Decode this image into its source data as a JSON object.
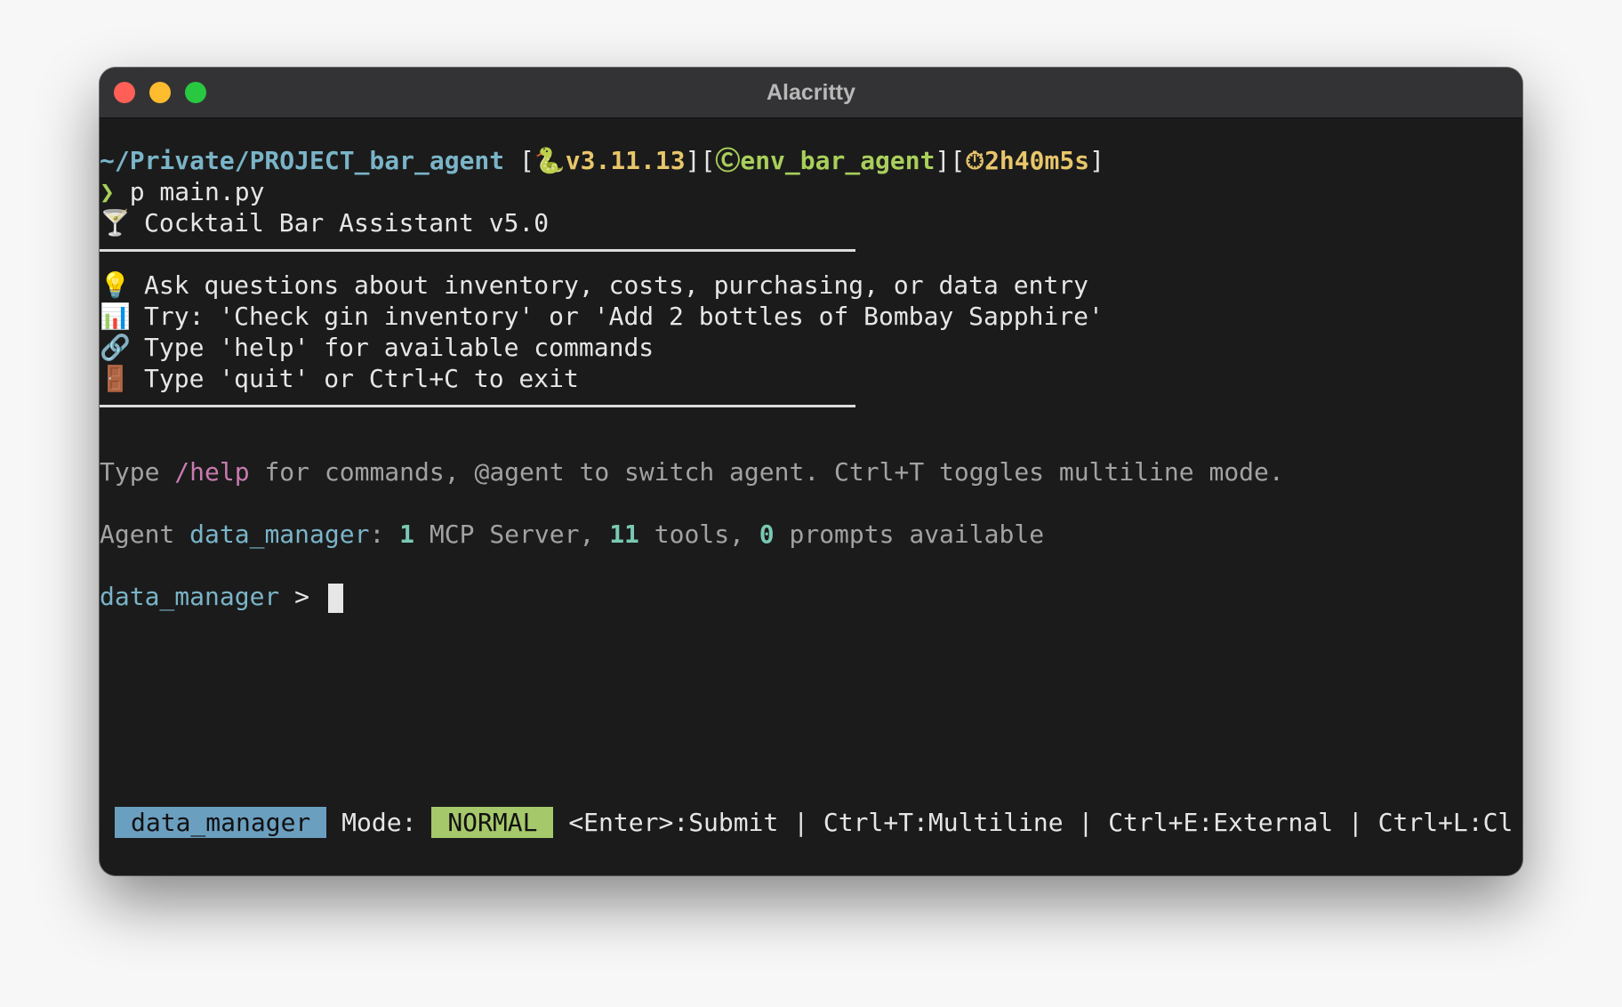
{
  "window": {
    "title": "Alacritty"
  },
  "prompt": {
    "path": "~/Private/PROJECT_bar_agent",
    "python_icon": "🐍",
    "python_version": "v3.11.13",
    "env_icon": "Ⓒ",
    "env_name": "env_bar_agent",
    "timer_icon": "⏱",
    "duration": "2h40m5s",
    "arrow": "❯",
    "command": "p main.py"
  },
  "banner": {
    "title_icon": "🍸",
    "title": "Cocktail Bar Assistant v5.0",
    "items": [
      {
        "icon": "💡",
        "text": "Ask questions about inventory, costs, purchasing, or data entry"
      },
      {
        "icon": "📊",
        "text": "Try: 'Check gin inventory' or 'Add 2 bottles of Bombay Sapphire'"
      },
      {
        "icon": "🔗",
        "text": "Type 'help' for available commands"
      },
      {
        "icon": "🚪",
        "text": "Type 'quit' or Ctrl+C to exit"
      }
    ]
  },
  "hint": {
    "before": "Type ",
    "help_cmd": "/help",
    "after": " for commands, @agent to switch agent. Ctrl+T toggles multiline mode."
  },
  "agent_info": {
    "prefix": "Agent ",
    "name": "data_manager",
    "colon": ": ",
    "servers_count": "1",
    "servers_label": " MCP Server, ",
    "tools_count": "11",
    "tools_label": " tools, ",
    "prompts_count": "0",
    "prompts_label": " prompts available"
  },
  "input_prompt": {
    "agent": "data_manager",
    "symbol": " > "
  },
  "status_bar": {
    "agent": "data_manager",
    "mode_label": "Mode:",
    "mode": "NORMAL",
    "shortcuts": "<Enter>:Submit | Ctrl+T:Multiline | Ctrl+E:External | Ctrl+L:Cl"
  },
  "colors": {
    "background": "#1b1b1b",
    "path": "#7ab4c8",
    "version": "#e8c66a",
    "env": "#a9cf5b",
    "help_cmd": "#c87bb0",
    "counts": "#79c9b3",
    "agent_badge": "#6b9fc0",
    "mode_badge": "#a5c86b"
  }
}
